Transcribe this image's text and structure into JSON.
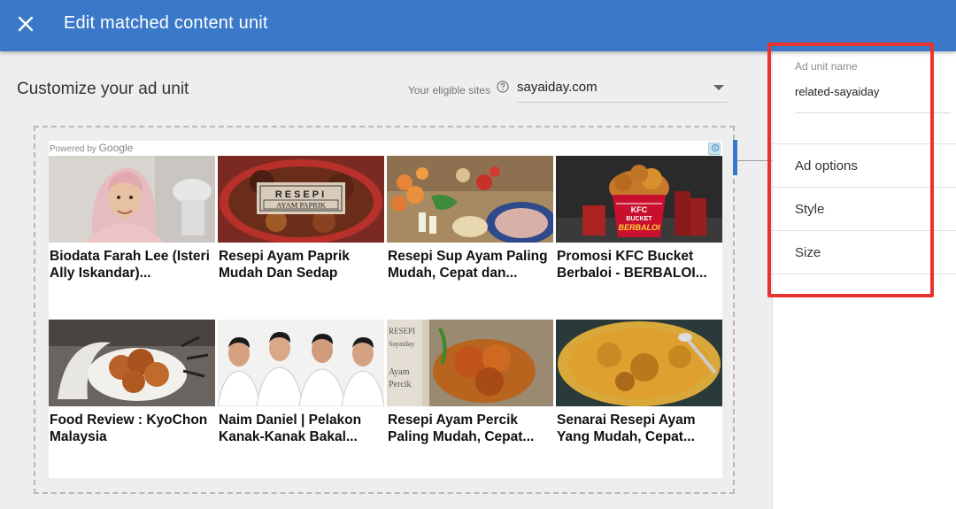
{
  "header": {
    "title": "Edit matched content unit"
  },
  "main": {
    "heading": "Customize your ad unit",
    "eligible_sites_label": "Your eligible sites",
    "selected_site": "sayaiday.com"
  },
  "ad_preview": {
    "powered_by": "Powered by",
    "powered_by_brand": "Google",
    "info_glyph": "i",
    "cards": [
      {
        "title": "Biodata Farah Lee (Isteri Ally Iskandar)...",
        "image": "woman-hijab-photo"
      },
      {
        "title": "Resepi Ayam Paprik Mudah Dan Sedap",
        "image": "ayam-paprik-dish-photo",
        "overlay_line1": "RESEPI",
        "overlay_line2": "AYAM PAPRIK"
      },
      {
        "title": "Resepi Sup Ayam Paling Mudah, Cepat dan...",
        "image": "soup-ingredients-photo"
      },
      {
        "title": "Promosi KFC Bucket Berbaloi - BERBALOI...",
        "image": "kfc-bucket-photo",
        "overlay_line1": "KFC",
        "overlay_line2": "BUCKET",
        "overlay_line3": "BERBALOI"
      },
      {
        "title": "Food Review : KyoChon Malaysia",
        "image": "fried-chicken-photo"
      },
      {
        "title": "Naim Daniel | Pelakon Kanak-Kanak Bakal...",
        "image": "four-boys-photo"
      },
      {
        "title": "Resepi Ayam Percik Paling Mudah, Cepat...",
        "image": "ayam-percik-photo",
        "overlay_line1": "RESEPI",
        "overlay_line2": "Sayaiday",
        "overlay_line3": "Ayam",
        "overlay_line4": "Percik"
      },
      {
        "title": "Senarai Resepi Ayam Yang Mudah, Cepat...",
        "image": "curry-chicken-photo"
      }
    ]
  },
  "side_panel": {
    "ad_unit_name_label": "Ad unit name",
    "ad_unit_name_value": "related-sayaiday",
    "items": [
      {
        "label": "Ad options"
      },
      {
        "label": "Style"
      },
      {
        "label": "Size"
      }
    ]
  },
  "colors": {
    "header_blue": "#3a78c9",
    "highlight_red": "#e8342f"
  },
  "icons": [
    "close-icon",
    "help-icon",
    "chevron-down-icon",
    "info-icon"
  ]
}
